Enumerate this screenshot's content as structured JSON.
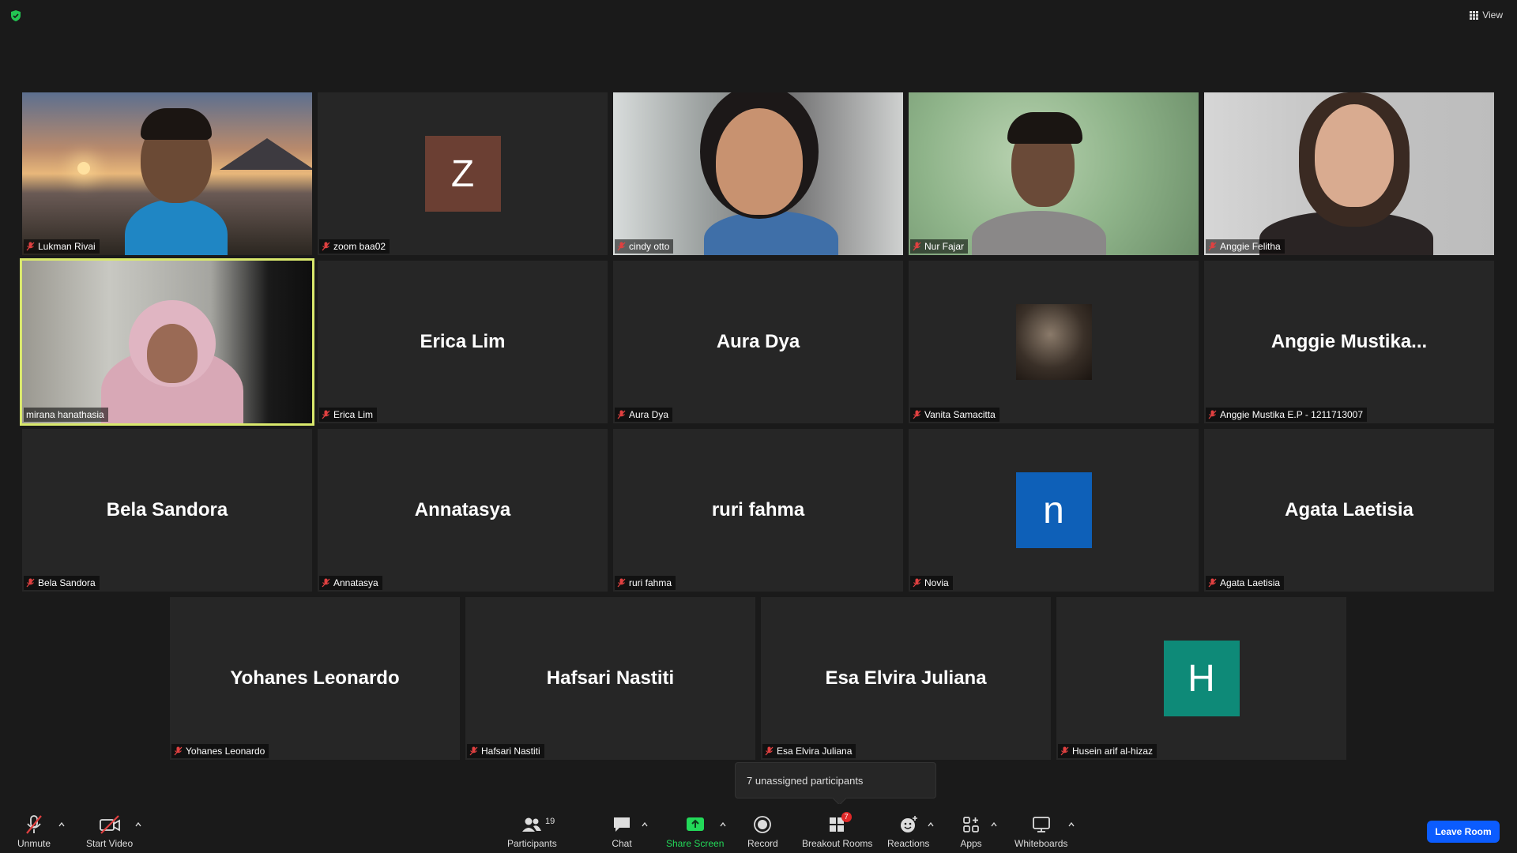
{
  "top": {
    "view_label": "View"
  },
  "tiles": [
    {
      "big": "",
      "label": "Lukman Rivai"
    },
    {
      "big": "",
      "label": "zoom baa02",
      "initial": "Z"
    },
    {
      "big": "",
      "label": "cindy otto"
    },
    {
      "big": "",
      "label": "Nur Fajar"
    },
    {
      "big": "",
      "label": "Anggie Felitha"
    },
    {
      "big": "",
      "label": "mirana hanathasia"
    },
    {
      "big": "Erica Lim",
      "label": "Erica Lim"
    },
    {
      "big": "Aura Dya",
      "label": "Aura Dya"
    },
    {
      "big": "",
      "label": "Vanita Samacitta"
    },
    {
      "big": "Anggie  Mustika...",
      "label": "Anggie Mustika E.P - 1211713007"
    },
    {
      "big": "Bela Sandora",
      "label": "Bela Sandora"
    },
    {
      "big": "Annatasya",
      "label": "Annatasya"
    },
    {
      "big": "ruri fahma",
      "label": "ruri fahma"
    },
    {
      "big": "",
      "label": "Novia",
      "initial": "n"
    },
    {
      "big": "Agata Laetisia",
      "label": "Agata Laetisia"
    },
    {
      "big": "Yohanes Leonardo",
      "label": "Yohanes Leonardo"
    },
    {
      "big": "Hafsari Nastiti",
      "label": "Hafsari Nastiti"
    },
    {
      "big": "Esa Elvira Juliana",
      "label": "Esa Elvira Juliana"
    },
    {
      "big": "",
      "label": "Husein arif al-hizaz",
      "initial": "H"
    }
  ],
  "tooltip": "7 unassigned participants",
  "toolbar": {
    "unmute": "Unmute",
    "start_video": "Start Video",
    "participants": "Participants",
    "participants_count": "19",
    "chat": "Chat",
    "share_screen": "Share Screen",
    "record": "Record",
    "breakout_rooms": "Breakout Rooms",
    "breakout_badge": "7",
    "reactions": "Reactions",
    "apps": "Apps",
    "whiteboards": "Whiteboards",
    "leave": "Leave Room"
  },
  "colors": {
    "active_speaker": "#d9e86c",
    "share_green": "#23d959",
    "leave_blue": "#0b5cff",
    "avatar_z": "#6b3f33",
    "avatar_n": "#0e60b8",
    "avatar_h": "#0e8a78"
  }
}
